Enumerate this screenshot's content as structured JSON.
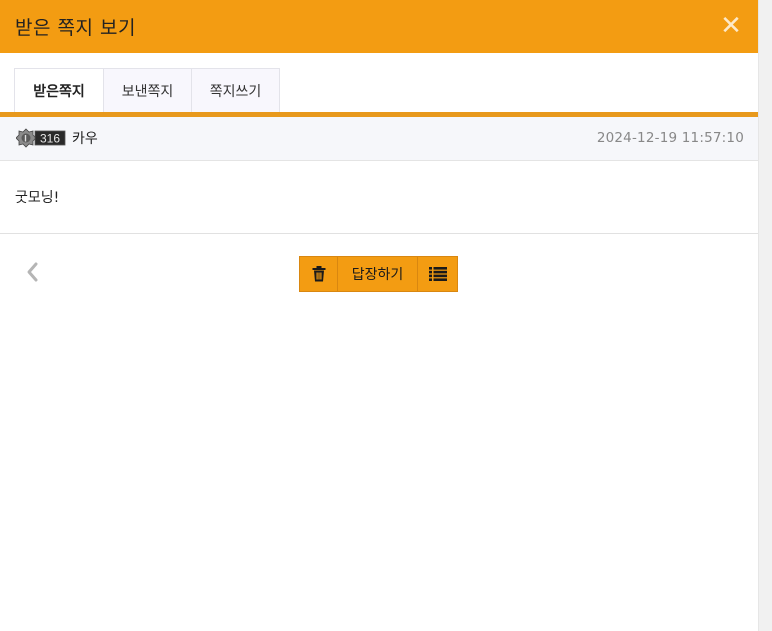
{
  "window": {
    "title": "받은 쪽지 보기",
    "close_icon": "close-icon"
  },
  "tabs": [
    {
      "label": "받은쪽지",
      "active": true
    },
    {
      "label": "보낸쪽지",
      "active": false
    },
    {
      "label": "쪽지쓰기",
      "active": false
    }
  ],
  "message": {
    "level": "316",
    "sender": "카우",
    "date": "2024-12-19 11:57:10",
    "body": "굿모닝!"
  },
  "actions": {
    "delete_icon": "trash-icon",
    "reply_label": "답장하기",
    "list_icon": "list-icon",
    "prev_icon": "chevron-left-icon"
  },
  "colors": {
    "accent": "#f39c12",
    "header_bg": "#f6f7fa",
    "date_text": "#888888"
  }
}
